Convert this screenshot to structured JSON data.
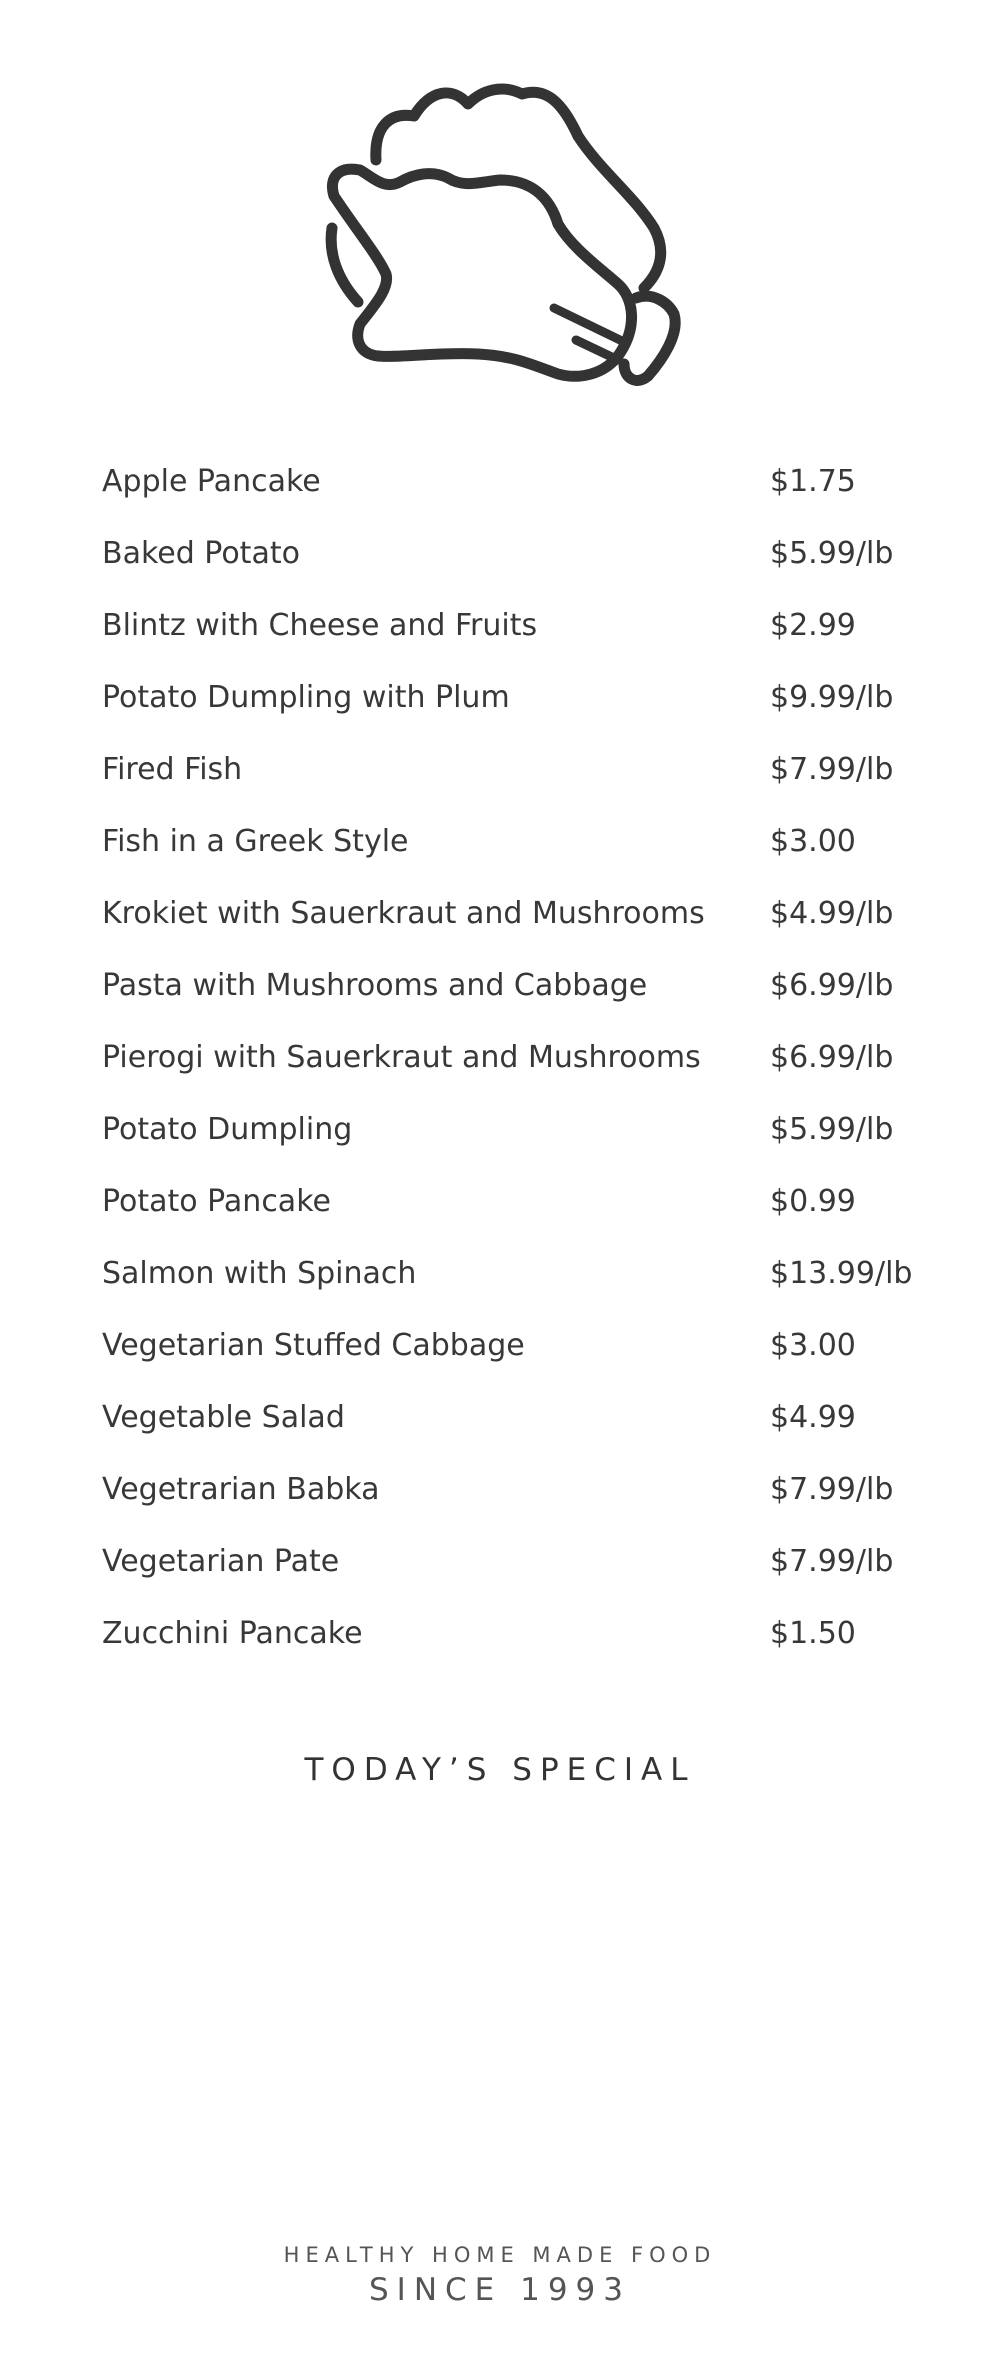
{
  "logo": {
    "icon": "chef-hat-icon",
    "color": "#333333"
  },
  "menu": {
    "items": [
      {
        "name": "Apple Pancake",
        "price": "$1.75"
      },
      {
        "name": "Baked Potato",
        "price": "$5.99/lb"
      },
      {
        "name": "Blintz with Cheese and Fruits",
        "price": "$2.99"
      },
      {
        "name": "Potato Dumpling with Plum",
        "price": "$9.99/lb"
      },
      {
        "name": "Fired Fish",
        "price": "$7.99/lb"
      },
      {
        "name": "Fish in a Greek Style",
        "price": "$3.00"
      },
      {
        "name": "Krokiet with Sauerkraut and Mushrooms",
        "price": "$4.99/lb"
      },
      {
        "name": "Pasta with Mushrooms and Cabbage",
        "price": "$6.99/lb"
      },
      {
        "name": "Pierogi with Sauerkraut and Mushrooms",
        "price": "$6.99/lb"
      },
      {
        "name": "Potato Dumpling",
        "price": "$5.99/lb"
      },
      {
        "name": "Potato Pancake",
        "price": "$0.99"
      },
      {
        "name": "Salmon with Spinach",
        "price": "$13.99/lb"
      },
      {
        "name": "Vegetarian Stuffed Cabbage",
        "price": "$3.00"
      },
      {
        "name": "Vegetable Salad",
        "price": "$4.99"
      },
      {
        "name": "Vegetrarian Babka",
        "price": "$7.99/lb"
      },
      {
        "name": "Vegetarian Pate",
        "price": "$7.99/lb"
      },
      {
        "name": "Zucchini Pancake",
        "price": "$1.50"
      }
    ]
  },
  "special": {
    "title": "TODAY’S SPECIAL"
  },
  "footer": {
    "tagline": "HEALTHY HOME MADE FOOD",
    "since": "SINCE 1993"
  }
}
